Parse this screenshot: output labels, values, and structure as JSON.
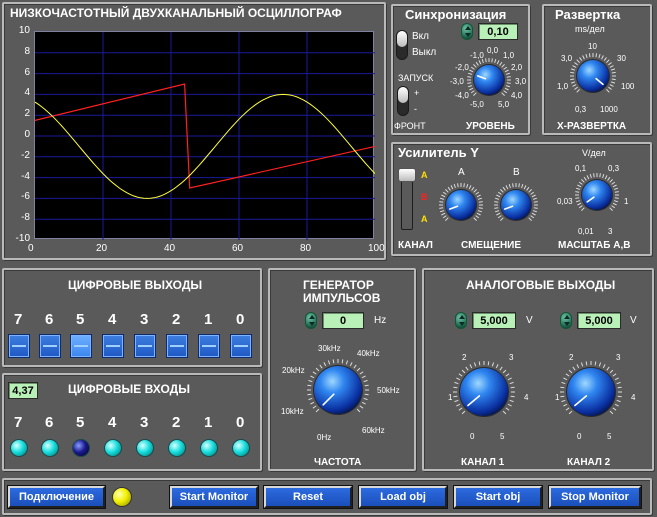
{
  "scope": {
    "title": "НИЗКОЧАСТОТНЫЙ ДВУХКАНАЛЬНЫЙ ОСЦИЛЛОГРАФ",
    "y_ticks": [
      "10",
      "8",
      "6",
      "4",
      "2",
      "0",
      "-2",
      "-4",
      "-6",
      "-8",
      "-10"
    ],
    "x_ticks": [
      "0",
      "20",
      "40",
      "60",
      "80",
      "100"
    ],
    "colors": {
      "background": "#000000",
      "grid": "#1a1a9a",
      "channel_a": "#ffff33",
      "channel_b": "#ff2020"
    }
  },
  "sync": {
    "title": "Синхронизация",
    "on_label": "Вкл",
    "off_label": "Выкл",
    "launch_label": "ЗАПУСК",
    "plus_label": "+",
    "minus_label": "-",
    "front_label": "ФРОНТ",
    "level_value": "0,10",
    "level_label": "УРОВЕНЬ",
    "level_ticks": [
      "-1,0",
      "0,0",
      "1,0",
      "-2,0",
      "2,0",
      "-3,0",
      "3,0",
      "-4,0",
      "4,0",
      "-5,0",
      "5,0"
    ]
  },
  "sweep": {
    "title": "Развертка",
    "unit": "ms/дел",
    "ticks": [
      "10",
      "3,0",
      "30",
      "1,0",
      "100",
      "0,3",
      "1000"
    ],
    "label": "X-РАЗВЕРТКА"
  },
  "amp": {
    "title": "Усилитель Y",
    "unit": "V/дел",
    "channel_switch": [
      "A",
      "B",
      "A"
    ],
    "channel_label": "КАНАЛ",
    "offset_label": "СМЕЩЕНИЕ",
    "offset_a": "A",
    "offset_b": "B",
    "scale_ticks": [
      "0,1",
      "0,3",
      "0,03",
      "1",
      "0,01",
      "3"
    ],
    "scale_label": "МАСШТАБ А,В"
  },
  "digital_out": {
    "title": "ЦИФРОВЫЕ ВЫХОДЫ",
    "bits": [
      "7",
      "6",
      "5",
      "4",
      "3",
      "2",
      "1",
      "0"
    ],
    "states": [
      false,
      false,
      true,
      false,
      false,
      false,
      false,
      false
    ]
  },
  "digital_in": {
    "title": "ЦИФРОВЫЕ ВХОДЫ",
    "value": "4,37",
    "bits": [
      "7",
      "6",
      "5",
      "4",
      "3",
      "2",
      "1",
      "0"
    ],
    "states": [
      true,
      true,
      false,
      true,
      true,
      true,
      true,
      true
    ]
  },
  "generator": {
    "title_line1": "ГЕНЕРАТОР",
    "title_line2": "ИМПУЛЬСОВ",
    "value": "0",
    "unit": "Hz",
    "ticks": [
      "30kHz",
      "40kHz",
      "20kHz",
      "50kHz",
      "10kHz",
      "60kHz",
      "0Hz"
    ],
    "label": "ЧАСТОТА"
  },
  "analog_out": {
    "title": "АНАЛОГОВЫЕ ВЫХОДЫ",
    "ch1_value": "5,000",
    "ch2_value": "5,000",
    "unit": "V",
    "ticks": [
      "2",
      "3",
      "1",
      "4",
      "0",
      "5"
    ],
    "ch1_label": "КАНАЛ 1",
    "ch2_label": "КАНАЛ 2"
  },
  "toolbar": {
    "connect": "Подключение",
    "start_monitor": "Start Monitor",
    "reset": "Reset",
    "load_obj": "Load obj",
    "start_obj": "Start obj",
    "stop_monitor": "Stop Monitor"
  }
}
